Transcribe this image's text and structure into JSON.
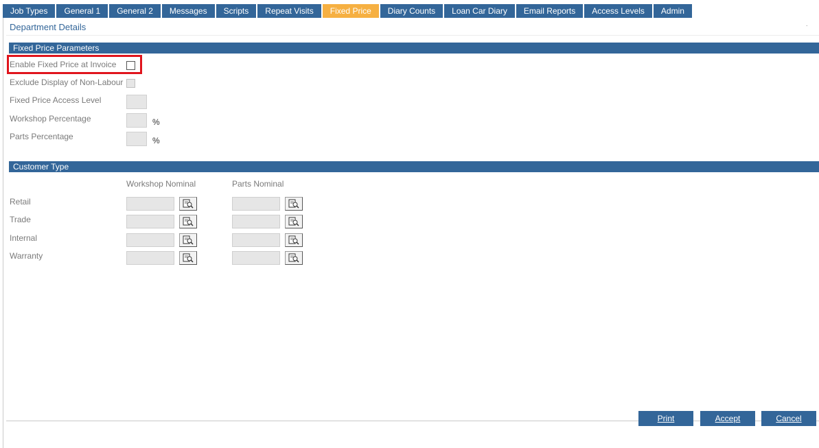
{
  "tabs": [
    {
      "label": "Job Types"
    },
    {
      "label": "General 1"
    },
    {
      "label": "General 2"
    },
    {
      "label": "Messages"
    },
    {
      "label": "Scripts"
    },
    {
      "label": "Repeat Visits"
    },
    {
      "label": "Fixed Price",
      "active": true
    },
    {
      "label": "Diary Counts"
    },
    {
      "label": "Loan Car Diary"
    },
    {
      "label": "Email Reports"
    },
    {
      "label": "Access Levels"
    },
    {
      "label": "Admin"
    }
  ],
  "page_title": "Department Details",
  "fixed_price": {
    "header": "Fixed Price Parameters",
    "enable_label": "Enable Fixed Price at Invoice",
    "exclude_label": "Exclude Display of Non-Labour",
    "access_level_label": "Fixed Price Access Level",
    "workshop_pct_label": "Workshop Percentage",
    "parts_pct_label": "Parts Percentage",
    "percent_symbol": "%"
  },
  "customer_type": {
    "header": "Customer Type",
    "col_workshop": "Workshop Nominal",
    "col_parts": "Parts Nominal",
    "rows": [
      {
        "label": "Retail"
      },
      {
        "label": "Trade"
      },
      {
        "label": "Internal"
      },
      {
        "label": "Warranty"
      }
    ]
  },
  "buttons": {
    "print": "Print",
    "accept": "Accept",
    "cancel": "Cancel"
  },
  "colors": {
    "accent": "#336699",
    "active_tab": "#f6b042",
    "highlight": "#e0141c"
  }
}
